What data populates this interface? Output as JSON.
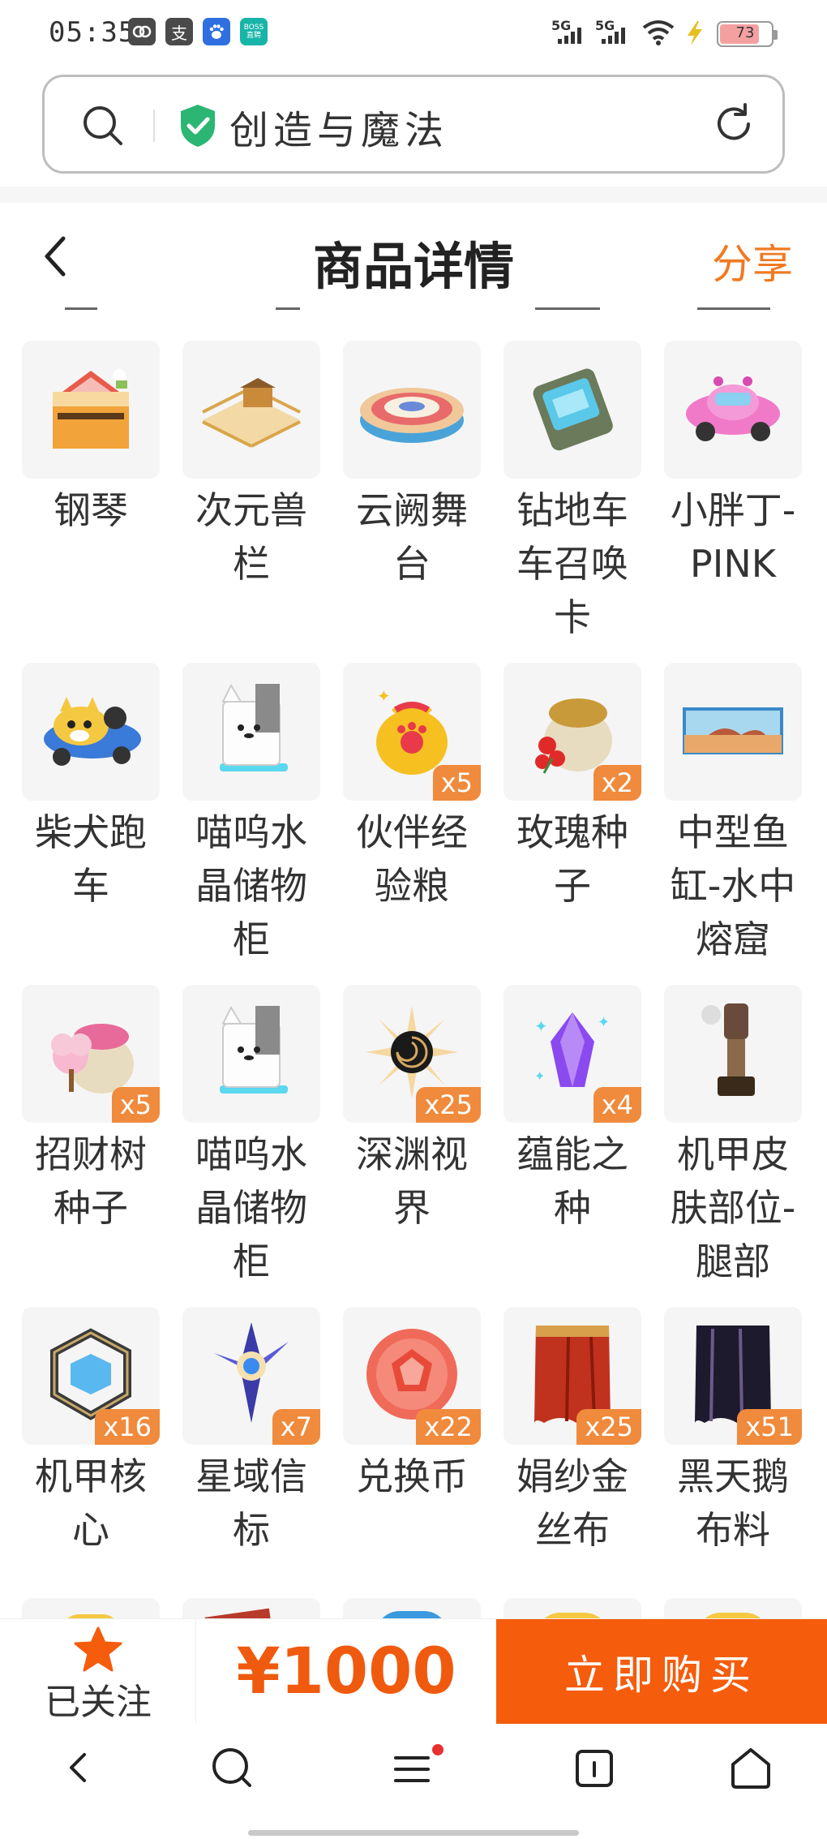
{
  "status_bar": {
    "time": "05:35",
    "apps": [
      {
        "icon": "gallery-app-icon",
        "color": "#4a4a4a"
      },
      {
        "icon": "alipay-app-icon",
        "color": "#4a4a4a",
        "glyph": "支"
      },
      {
        "icon": "baidu-app-icon",
        "color": "#2f6fe0"
      },
      {
        "icon": "boss-zhipin-app-icon",
        "color": "#18b4a8",
        "text": "BOSS 直聘"
      }
    ],
    "signal_1": "5G",
    "signal_2": "5G",
    "battery": "73"
  },
  "browser": {
    "site_title": "创造与魔法"
  },
  "header": {
    "title": "商品详情",
    "share_label": "分享"
  },
  "items": [
    {
      "name": "钢琴",
      "qty": "",
      "icon": "piano-icon"
    },
    {
      "name": "次元兽栏",
      "qty": "",
      "icon": "fence-pen-icon"
    },
    {
      "name": "云阙舞台",
      "qty": "",
      "icon": "round-stage-icon"
    },
    {
      "name": "钻地车车召唤卡",
      "qty": "",
      "icon": "summon-card-icon"
    },
    {
      "name": "小胖丁-PINK",
      "qty": "",
      "icon": "pink-car-icon"
    },
    {
      "name": "柴犬跑车",
      "qty": "",
      "icon": "shiba-car-icon"
    },
    {
      "name": "喵呜水晶储物柜",
      "qty": "",
      "icon": "cat-cabinet-icon"
    },
    {
      "name": "伙伴经验粮",
      "qty": "x5",
      "icon": "food-bag-icon"
    },
    {
      "name": "玫瑰种子",
      "qty": "x2",
      "icon": "rose-seed-bag-icon"
    },
    {
      "name": "中型鱼缸-水中熔窟",
      "qty": "",
      "icon": "aquarium-icon"
    },
    {
      "name": "招财树种子",
      "qty": "x5",
      "icon": "fortune-tree-seed-icon"
    },
    {
      "name": "喵呜水晶储物柜",
      "qty": "",
      "icon": "cat-cabinet-icon"
    },
    {
      "name": "深渊视界",
      "qty": "x25",
      "icon": "abyss-vortex-icon"
    },
    {
      "name": "蕴能之种",
      "qty": "x4",
      "icon": "purple-crystal-icon"
    },
    {
      "name": "机甲皮肤部位-腿部",
      "qty": "",
      "icon": "mech-leg-icon"
    },
    {
      "name": "机甲核心",
      "qty": "x16",
      "icon": "mech-core-icon"
    },
    {
      "name": "星域信标",
      "qty": "x7",
      "icon": "star-beacon-icon"
    },
    {
      "name": "兑换币",
      "qty": "x22",
      "icon": "exchange-coin-icon"
    },
    {
      "name": "娟纱金丝布",
      "qty": "x25",
      "icon": "red-cloth-icon"
    },
    {
      "name": "黑天鹅布料",
      "qty": "x51",
      "icon": "black-cloth-icon"
    }
  ],
  "buy_bar": {
    "follow_label": "已关注",
    "price": "¥1000",
    "buy_label": "立即购买"
  },
  "colors": {
    "accent": "#f55c0c",
    "share": "#f07a22",
    "qty_badge": "#f08a3c"
  }
}
